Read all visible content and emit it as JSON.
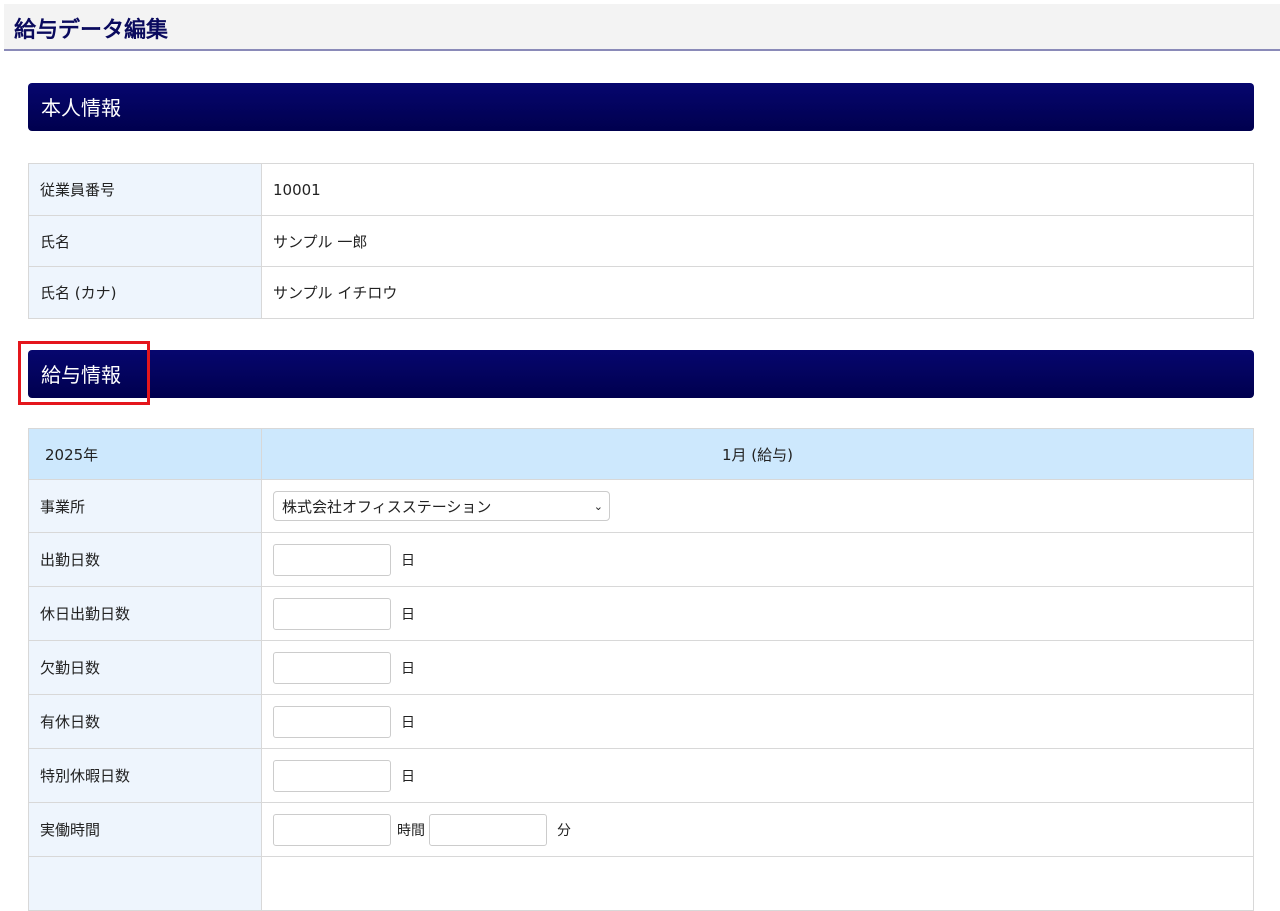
{
  "page_title": "給与データ編集",
  "personal": {
    "title": "本人情報",
    "rows": [
      {
        "label": "従業員番号",
        "value": "10001"
      },
      {
        "label": "氏名",
        "value": "サンプル 一郎"
      },
      {
        "label": "氏名 (カナ)",
        "value": "サンプル イチロウ"
      }
    ]
  },
  "salary": {
    "title": "給与情報",
    "year": "2025年",
    "month_header": "1月 (給与)",
    "office_label": "事業所",
    "office_value": "株式会社オフィスステーション",
    "rows": [
      {
        "label": "出勤日数",
        "unit": "日"
      },
      {
        "label": "休日出勤日数",
        "unit": "日"
      },
      {
        "label": "欠勤日数",
        "unit": "日"
      },
      {
        "label": "有休日数",
        "unit": "日"
      },
      {
        "label": "特別休暇日数",
        "unit": "日"
      }
    ],
    "work_time": {
      "label": "実働時間",
      "unit_hours": "時間",
      "unit_minutes": "分"
    }
  },
  "colors": {
    "header": "#00004e",
    "highlight": "#e4161c"
  }
}
